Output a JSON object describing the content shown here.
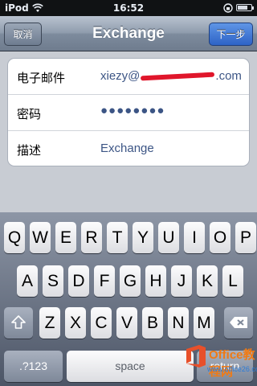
{
  "status_bar": {
    "carrier": "iPod",
    "time": "16:52",
    "battery_level": 0.75
  },
  "nav": {
    "cancel": "取消",
    "title": "Exchange",
    "next": "下一步"
  },
  "form": {
    "email_label": "电子邮件",
    "email_prefix": "xiezy@",
    "email_suffix": ".com",
    "password_label": "密码",
    "password_value": "●●●●●●●●",
    "description_label": "描述",
    "description_value": "Exchange"
  },
  "keyboard": {
    "row1": [
      "Q",
      "W",
      "E",
      "R",
      "T",
      "Y",
      "U",
      "I",
      "O",
      "P"
    ],
    "row2": [
      "A",
      "S",
      "D",
      "F",
      "G",
      "H",
      "J",
      "K",
      "L"
    ],
    "row3": [
      "Z",
      "X",
      "C",
      "V",
      "B",
      "N",
      "M"
    ],
    "numbers": ".?123",
    "space": "space",
    "return": "return"
  },
  "watermark": {
    "brand": "Office教程网",
    "url": "www.office26.com"
  }
}
